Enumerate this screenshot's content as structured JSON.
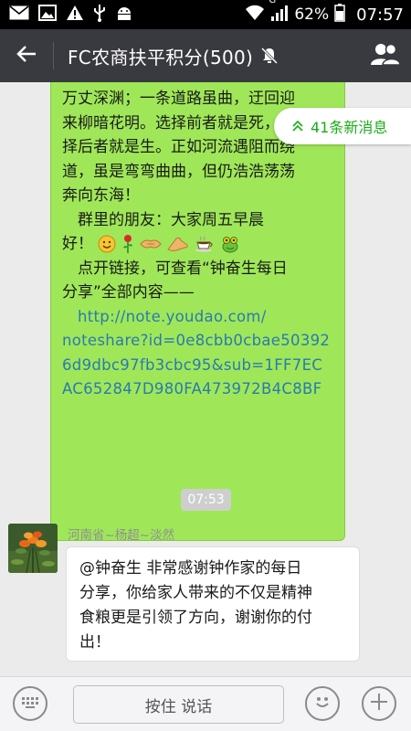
{
  "status_bar": {
    "icons": [
      "mail-icon",
      "image-icon",
      "warning-icon",
      "usb-icon",
      "android-icon",
      "wifi-icon",
      "signal-icon",
      "battery-icon"
    ],
    "network_type": "G",
    "battery": "62%",
    "time": "07:57"
  },
  "header": {
    "title": "FC农商扶平积分(500)",
    "back_icon": "arrow-left-icon",
    "mute_icon": "bell-muted-icon",
    "group_icon": "group-members-icon"
  },
  "new_messages": {
    "label": "41条新消息",
    "icon": "double-chevron-up-icon",
    "accent": "#1aad19"
  },
  "messages": [
    {
      "type": "outgoing",
      "lines": [
        "万丈深渊；一条道路虽曲，迂回迎",
        "来柳暗花明。选择前者就是死，选",
        "择后者就是生。正如河流遇阻而绕",
        "道，虽是弯弯曲曲，但仍浩浩荡荡",
        "奔向东海！",
        "　群里的朋友：大家周五早晨",
        "好！",
        "　点开链接，可查看“钟奋生每日",
        "分享”全部内容——"
      ],
      "emojis": [
        "smile-emoji",
        "rose-emoji",
        "handshake-emoji",
        "fist-emoji",
        "coffee-emoji",
        "frog-emoji"
      ],
      "link_lines": [
        "http://note.youdao.com/",
        "noteshare?id=0e8cbb0cbae50392",
        "6d9dbc97fb3cbc95&sub=1FF7EC",
        "AC652847D980FA473972B4C8BF"
      ],
      "bubble_color": "#9fe758",
      "link_color": "#2a7ab0"
    },
    {
      "type": "timestamp",
      "text": "07:53"
    },
    {
      "type": "incoming",
      "sender": "河南省~杨超~淡然",
      "lines": [
        "@钟奋生 非常感谢钟作家的每日",
        "分享，你给家人带来的不仅是精神",
        "食粮更是引领了方向，谢谢你的付",
        "出！"
      ],
      "bubble_color": "#ffffff"
    }
  ],
  "input_bar": {
    "hold_to_talk": "按住 说话",
    "keyboard_icon": "keyboard-icon",
    "emoji_icon": "emoji-icon",
    "plus_icon": "plus-icon"
  }
}
